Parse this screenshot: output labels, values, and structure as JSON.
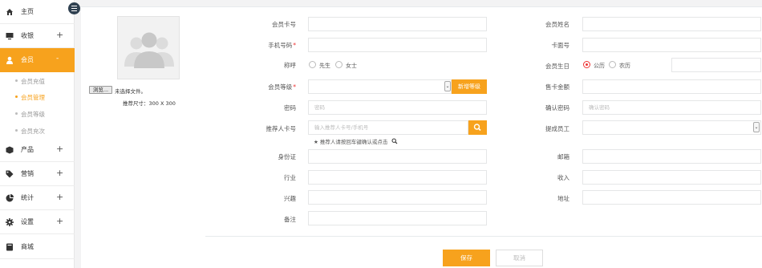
{
  "sidebar": {
    "items": [
      {
        "icon": "home-icon",
        "label": "主页",
        "plus": ""
      },
      {
        "icon": "monitor-icon",
        "label": "收银",
        "plus": "+"
      },
      {
        "icon": "user-icon",
        "label": "会员",
        "plus": "-"
      },
      {
        "icon": "box-icon",
        "label": "产品",
        "plus": "+"
      },
      {
        "icon": "tag-icon",
        "label": "营销",
        "plus": "+"
      },
      {
        "icon": "pie-chart-icon",
        "label": "统计",
        "plus": "+"
      },
      {
        "icon": "gear-icon",
        "label": "设置",
        "plus": "+"
      },
      {
        "icon": "book-icon",
        "label": "商城",
        "plus": ""
      }
    ],
    "member_subitems": [
      "会员充值",
      "会员管理",
      "会员等级",
      "会员充次"
    ],
    "active_item": "会员",
    "current_subitem": "会员管理"
  },
  "photo": {
    "browse_label": "浏览...",
    "no_file_text": "未选择文件。",
    "size_hint": "推荐尺寸：300 X 300"
  },
  "form": {
    "card_no": {
      "label": "会员卡号",
      "value": ""
    },
    "name": {
      "label": "会员姓名",
      "value": ""
    },
    "phone": {
      "label": "手机号码",
      "required_mark": "*",
      "value": ""
    },
    "face_no": {
      "label": "卡面号",
      "value": ""
    },
    "title": {
      "label": "称呼",
      "options": [
        "先生",
        "女士"
      ]
    },
    "birthday": {
      "label": "会员生日",
      "options": [
        "公历",
        "农历"
      ],
      "selected": "公历",
      "value": ""
    },
    "level": {
      "label": "会员等级",
      "required_mark": "*",
      "value": "",
      "add_button": "新增等级"
    },
    "card_price": {
      "label": "售卡金额",
      "value": ""
    },
    "password": {
      "label": "密码",
      "placeholder": "密码"
    },
    "confirm_password": {
      "label": "确认密码",
      "placeholder": "确认密码"
    },
    "referrer": {
      "label": "推荐人卡号",
      "placeholder": "输入推荐人卡号/手机号",
      "hint": "★ 推荐人请按回车键确认或点击"
    },
    "staff": {
      "label": "提成员工",
      "value": ""
    },
    "id_card": {
      "label": "身份证",
      "value": ""
    },
    "email": {
      "label": "邮箱",
      "value": ""
    },
    "industry": {
      "label": "行业",
      "value": ""
    },
    "income": {
      "label": "收入",
      "value": ""
    },
    "interest": {
      "label": "兴趣",
      "value": ""
    },
    "address": {
      "label": "地址",
      "value": ""
    },
    "remark": {
      "label": "备注",
      "value": ""
    }
  },
  "actions": {
    "save": "保存",
    "cancel": "取消"
  },
  "colors": {
    "accent": "#f7a21d",
    "sidebar_dark": "#2f4050",
    "required": "#e33333"
  }
}
